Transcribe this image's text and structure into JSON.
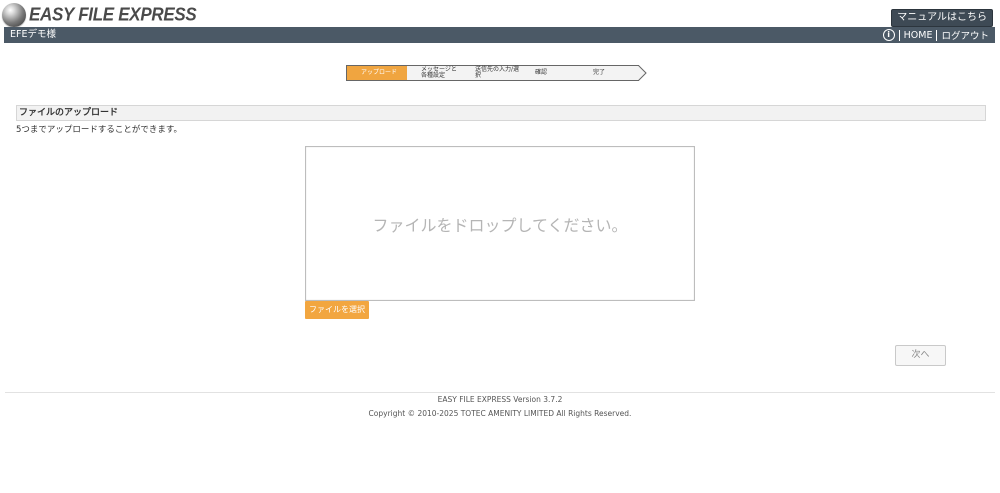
{
  "logo": {
    "text": "EASY FILE EXPRESS"
  },
  "manual_button": "マニュアルはこちら",
  "header": {
    "user_name": "EFEデモ様",
    "info_icon_glyph": "i",
    "home": "HOME",
    "logout": "ログアウト"
  },
  "steps": [
    {
      "label": "アップロード",
      "active": true
    },
    {
      "label": "メッセージと\n各種設定",
      "active": false
    },
    {
      "label": "送信先の入力/選択",
      "active": false
    },
    {
      "label": "確認",
      "active": false
    },
    {
      "label": "完了",
      "active": false
    }
  ],
  "section": {
    "title": "ファイルのアップロード",
    "description": "5つまでアップロードすることができます。"
  },
  "dropzone": {
    "text": "ファイルをドロップしてください。"
  },
  "select_button": "ファイルを選択",
  "next_button": "次へ",
  "footer": {
    "version": "EASY FILE EXPRESS Version 3.7.2",
    "copyright": "Copyright © 2010-2025 TOTEC AMENITY LIMITED All Rights Reserved."
  },
  "colors": {
    "header_bg": "#4b5966",
    "accent": "#f0a540",
    "step_inactive": "#f3f3f3"
  }
}
